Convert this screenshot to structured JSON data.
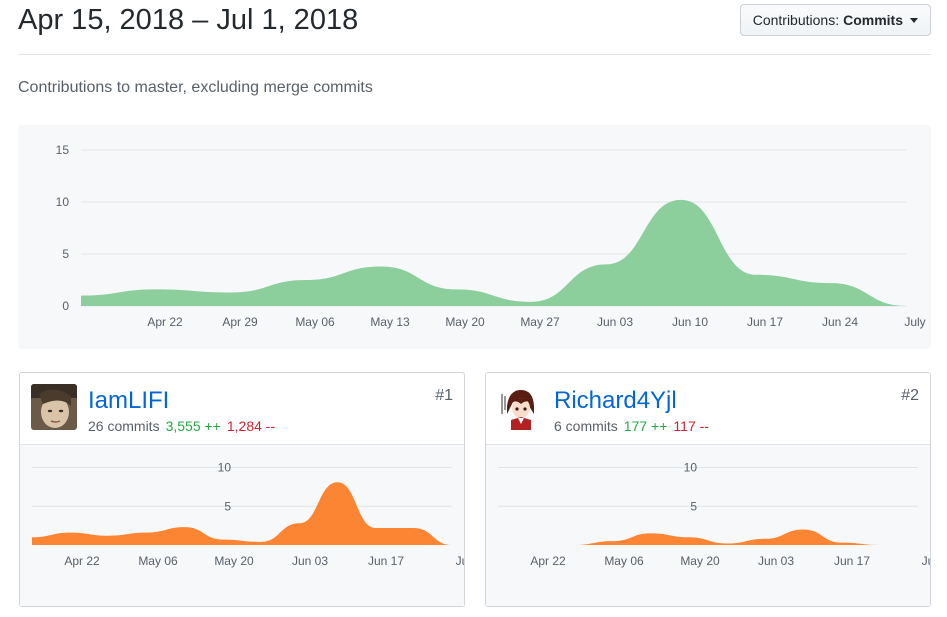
{
  "header": {
    "date_range": "Apr 15, 2018 – Jul 1, 2018",
    "contrib_button": {
      "prefix": "Contributions: ",
      "value": "Commits"
    }
  },
  "subtitle": "Contributions to master, excluding merge commits",
  "colors": {
    "main_area": "#8cce9c",
    "user_area": "#fb8532",
    "link": "#0366d6",
    "additions": "#28a745",
    "deletions": "#cb2431"
  },
  "chart_data": [
    {
      "type": "area",
      "title": "",
      "x_ticks": [
        "Apr 22",
        "Apr 29",
        "May 06",
        "May 13",
        "May 20",
        "May 27",
        "Jun 03",
        "Jun 10",
        "Jun 17",
        "Jun 24",
        "July"
      ],
      "y_ticks": [
        "0",
        "5",
        "10",
        "15"
      ],
      "ylim": [
        0,
        15
      ],
      "x": [
        "Apr 15",
        "Apr 22",
        "Apr 29",
        "May 06",
        "May 13",
        "May 20",
        "May 27",
        "Jun 03",
        "Jun 10",
        "Jun 17",
        "Jun 24",
        "Jul 01"
      ],
      "series": [
        {
          "values": [
            1,
            1.6,
            1.3,
            2.5,
            3.8,
            1.6,
            0.4,
            4,
            10.2,
            3,
            2.2,
            0
          ]
        }
      ],
      "grid": true
    },
    {
      "type": "area",
      "title": "",
      "x_ticks": [
        "Apr 22",
        "May 06",
        "May 20",
        "Jun 03",
        "Jun 17",
        "Ju"
      ],
      "y_ticks": [
        "5",
        "10"
      ],
      "ylim": [
        0,
        12
      ],
      "x": [
        "Apr 15",
        "Apr 22",
        "Apr 29",
        "May 06",
        "May 13",
        "May 20",
        "May 27",
        "Jun 03",
        "Jun 10",
        "Jun 17",
        "Jun 24",
        "Jul 01"
      ],
      "series": [
        {
          "values": [
            1,
            1.6,
            1.2,
            1.6,
            2.3,
            0.7,
            0.4,
            2.8,
            8.1,
            2.2,
            2.2,
            0
          ]
        }
      ],
      "grid": true
    },
    {
      "type": "area",
      "title": "",
      "x_ticks": [
        "Apr 22",
        "May 06",
        "May 20",
        "Jun 03",
        "Jun 17",
        "Ju"
      ],
      "y_ticks": [
        "5",
        "10"
      ],
      "ylim": [
        0,
        12
      ],
      "x": [
        "Apr 15",
        "Apr 22",
        "Apr 29",
        "May 06",
        "May 13",
        "May 20",
        "May 27",
        "Jun 03",
        "Jun 10",
        "Jun 17",
        "Jun 24",
        "Jul 01"
      ],
      "series": [
        {
          "values": [
            0,
            0,
            0,
            0.5,
            1.5,
            1,
            0.2,
            0.8,
            2,
            0.3,
            0,
            0
          ]
        }
      ],
      "grid": true
    }
  ],
  "contributors": [
    {
      "rank": "#1",
      "name": "IamLIFI",
      "commits": "26 commits",
      "additions": "3,555 ++",
      "deletions": "1,284 --",
      "avatar": "portrait-avatar"
    },
    {
      "rank": "#2",
      "name": "Richard4Yjl",
      "commits": "6 commits",
      "additions": "177 ++",
      "deletions": "117 --",
      "avatar": "anime-character-avatar"
    }
  ]
}
